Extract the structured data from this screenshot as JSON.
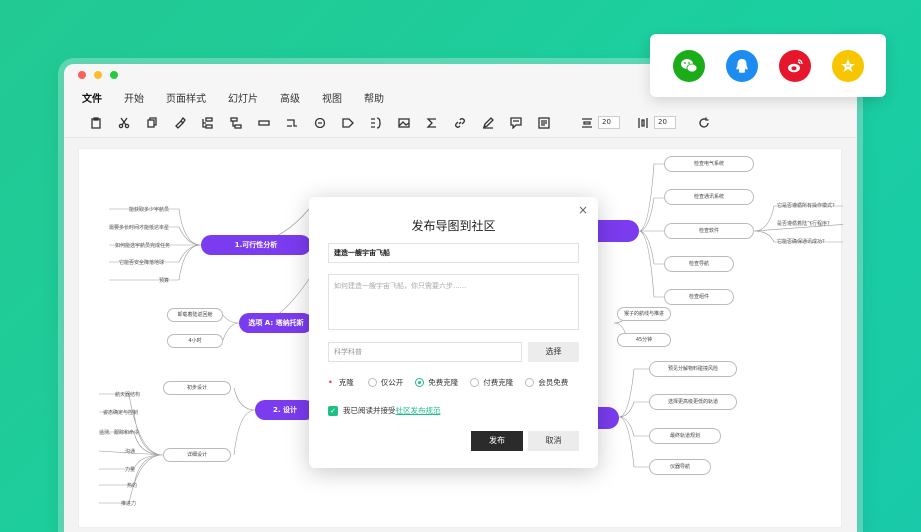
{
  "menu": [
    "文件",
    "开始",
    "页面样式",
    "幻灯片",
    "高级",
    "视图",
    "帮助"
  ],
  "toolbar": {
    "spacing_h": "20",
    "spacing_v": "20"
  },
  "share": {
    "icons": [
      "wechat-icon",
      "qq-icon",
      "weibo-icon",
      "favorite-star-icon"
    ],
    "colors": [
      "#1aad19",
      "#1d8cf0",
      "#e6162d",
      "#f7c600"
    ]
  },
  "mindmap": {
    "branches": [
      {
        "label": "1.可行性分析"
      },
      {
        "label": "选项 A: 塔纳托斯"
      },
      {
        "label": "2. 设计"
      }
    ],
    "left_leaves_1": [
      "能获取多少宇航员",
      "需要多长时间才能抵达本星",
      "如何能选宇航员完成任务",
      "它能否安全降落地球",
      "预算"
    ],
    "left_nodes_a": [
      "卸载着陆返回舱",
      "4小时"
    ],
    "left_design": [
      "初步设计",
      "详细设计"
    ],
    "left_design_leaves": [
      "航天器结构",
      "姿态确定与控制",
      "遥测、跟踪和命令",
      "沟通",
      "力量",
      "热的",
      "推进力"
    ],
    "right_nodes_1": [
      "检查电气系统",
      "检查通讯系统",
      "检查软件",
      "检查导航",
      "检查组件"
    ],
    "right_questions": [
      "它是否遵循所有操作模式?",
      "是否遵循着陆飞行程序?",
      "它能否确保通讯成功?"
    ],
    "right_mid": [
      "猴子的航线与推进",
      "45分钟"
    ],
    "right_lower": [
      "预见分解物料碰撞风险",
      "选择更高级更低的轨道",
      "最终轨道规划",
      "仪器导航"
    ]
  },
  "dialog": {
    "title": "发布导图到社区",
    "close": "×",
    "name_value": "建造一艘宇宙飞船",
    "desc_placeholder": "如何建造一艘宇宙飞船，你只需要六步......",
    "tag_placeholder": "科学科普",
    "select_label": "选择",
    "required_mark": "•",
    "license_label": "克隆",
    "options": [
      "仅公开",
      "免费克隆",
      "付费克隆",
      "会员免费"
    ],
    "selected_option": "免费克隆",
    "agree_text": "我已阅读并接受",
    "agree_link": "社区发布规范",
    "publish_label": "发布",
    "cancel_label": "取消"
  },
  "colors": {
    "accent": "#7b3cf0",
    "brand_green": "#1fbf86",
    "background": "#22c992"
  }
}
